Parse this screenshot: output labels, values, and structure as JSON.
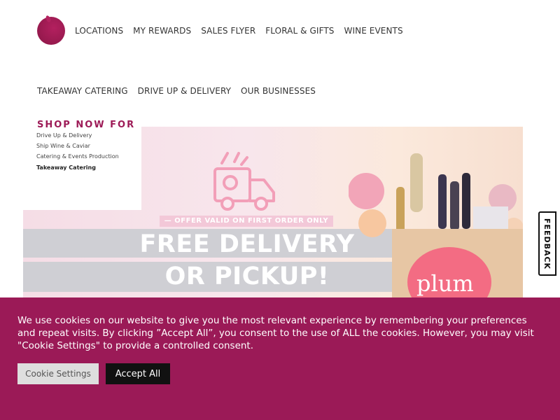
{
  "nav_primary": [
    "LOCATIONS",
    "MY REWARDS",
    "SALES FLYER",
    "FLORAL & GIFTS",
    "WINE EVENTS"
  ],
  "nav_secondary": [
    "TAKEAWAY CATERING",
    "DRIVE UP & DELIVERY",
    "OUR BUSINESSES"
  ],
  "shop_menu": {
    "title": "SHOP NOW FOR",
    "items": [
      "Drive Up & Delivery",
      "Ship Wine & Caviar",
      "Catering & Events Production",
      "Takeaway Catering"
    ],
    "active_item": "Takeaway Catering"
  },
  "hero": {
    "offer": "— OFFER VALID ON FIRST ORDER ONLY —",
    "headline_line1": "FREE DELIVERY",
    "headline_line2": "OR PICKUP!",
    "brand_text": "plum"
  },
  "feedback_label": "FEEDBACK",
  "cookie_banner": {
    "text": "We use cookies on our website to give you the most relevant experience by remembering your preferences and repeat visits. By clicking ”Accept All”, you consent to the use of ALL the cookies. However, you may visit \"Cookie Settings\" to provide a controlled consent.",
    "settings_label": "Cookie Settings",
    "accept_label": "Accept All"
  },
  "colors": {
    "brand": "#9b1a57",
    "accent_pink": "#f36c83"
  }
}
